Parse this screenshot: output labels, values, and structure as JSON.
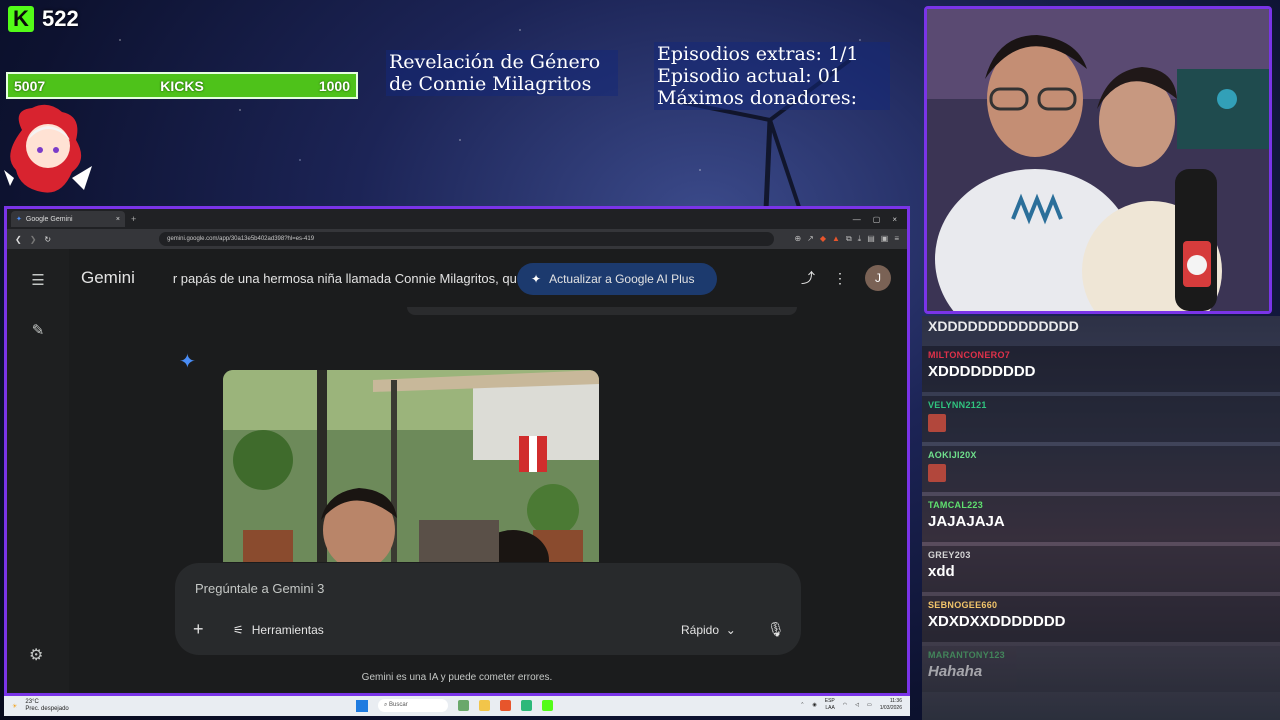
{
  "kick": {
    "logo": "K",
    "count": "522"
  },
  "goal": {
    "start": "5007",
    "label": "KICKS",
    "target": "1000",
    "progress": 1.0,
    "color": "#5bd31d"
  },
  "overlay": {
    "title_line1": "Revelación de Género",
    "title_line2": "de Connie Milagritos",
    "stats_line1": "Episodios extras: 1/1",
    "stats_line2": "Episodio actual: 01",
    "stats_line3": "Máximos donadores:"
  },
  "browser": {
    "tab_title": "Google Gemini",
    "tab_close": "×",
    "tab_new": "+",
    "url": "gemini.google.com/app/30a13e5b402ad398?hl=es-419",
    "win_min": "—",
    "win_max": "▢",
    "win_close": "×"
  },
  "gemini": {
    "brand": "Gemini",
    "conversation_title": "r papás de una hermosa niña llamada Connie Milagritos, qu",
    "upgrade_label": "Actualizar a Google AI Plus",
    "avatar_initial": "J",
    "composer_placeholder": "Pregúntale a Gemini 3",
    "tools_label": "Herramientas",
    "mode_label": "Rápido",
    "disclaimer": "Gemini es una IA y puede cometer errores.",
    "accent": "#4a8df6"
  },
  "taskbar": {
    "temperature": "23°C",
    "weather": "Prec. despejado",
    "search": "Buscar",
    "lang": "ESP",
    "lang2": "LAA",
    "time": "11:36",
    "date": "1/03/2026"
  },
  "chat": {
    "top_text": "XDDDDDDDDDDDDDD",
    "messages": [
      {
        "user": "MILTONCONERO7",
        "text": "XDDDDDDDDD",
        "color": "#e0314a"
      },
      {
        "user": "VELYNN2121",
        "text": "",
        "color": "#30c47f"
      },
      {
        "user": "AOKIJI20X",
        "text": "",
        "color": "#6fe08c"
      },
      {
        "user": "TAMCAL223",
        "text": "JAJAJAJA",
        "color": "#5fe06f"
      },
      {
        "user": "GREY203",
        "text": "xdd",
        "color": "#d6d6d6"
      },
      {
        "user": "SEBNOGEE660",
        "text": "XDXDXXDDDDDDD",
        "color": "#f1c46a"
      },
      {
        "user": "MARANTONY123",
        "text": "Hahaha",
        "color": "#47c26a"
      }
    ]
  }
}
